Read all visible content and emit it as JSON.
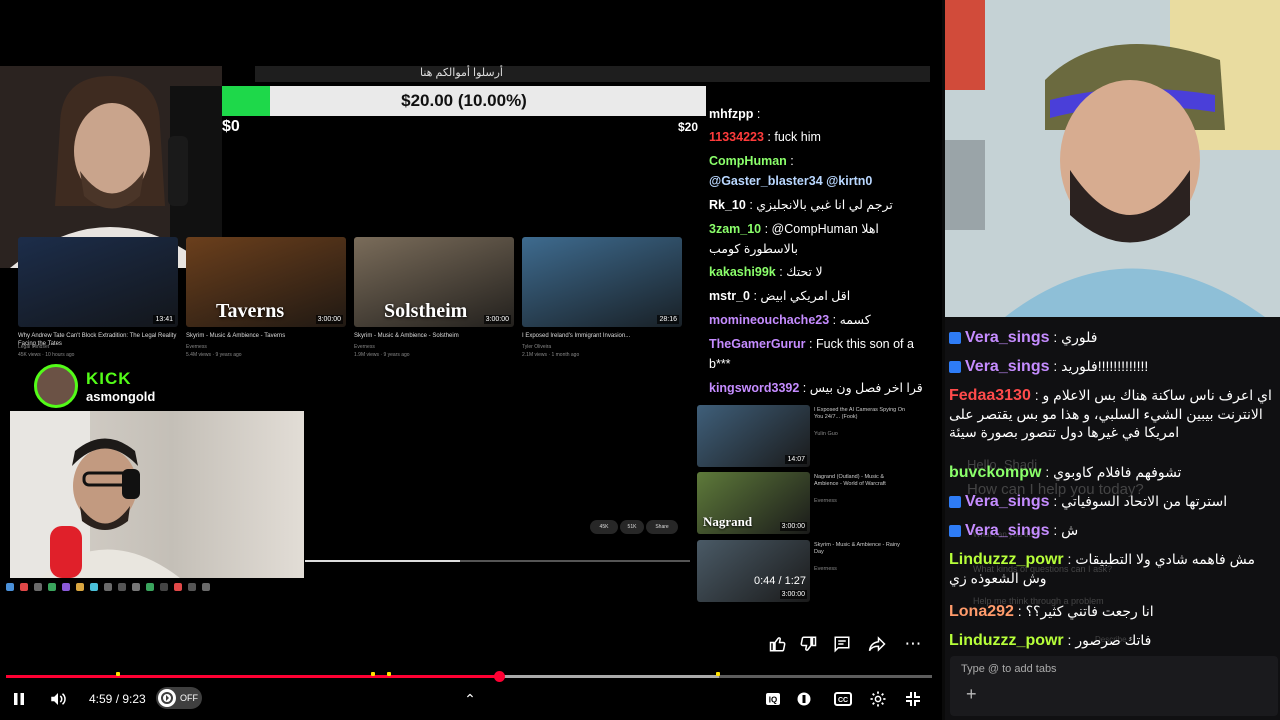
{
  "inner_window": {
    "title": "أرسلوا أموالكم هنا",
    "donation": {
      "label": "$20.00 (10.00%)",
      "progress": 0.1,
      "min_label": "$0",
      "max_label": "$20"
    },
    "thumbnails": [
      {
        "overlay": "",
        "title": "Why Andrew Tate Can't Block Extradition: The Legal Reality Facing the Tates",
        "channel": "Legal Mindset",
        "meta": "45K views · 10 hours ago",
        "duration": "13:41",
        "color": "#1c2d4a"
      },
      {
        "overlay": "Taverns",
        "title": "Skyrim - Music & Ambience - Taverns",
        "channel": "Everness",
        "meta": "5.4M views · 9 years ago",
        "duration": "3:00:00",
        "color": "#6b3f1c"
      },
      {
        "overlay": "Solstheim",
        "title": "Skyrim - Music & Ambience - Solstheim",
        "channel": "Everness",
        "meta": "1.9M views · 9 years ago",
        "duration": "3:00:00",
        "color": "#7a6c5a"
      },
      {
        "overlay": "",
        "title": "I Exposed Ireland's Immigrant Invasion...",
        "channel": "Tyler Oliveira",
        "meta": "2.1M views · 1 month ago",
        "duration": "28:16",
        "color": "#3e6b8f"
      }
    ],
    "kick": {
      "logo": "KICK",
      "username": "asmongold"
    },
    "chat": [
      {
        "user": "mhfzpp",
        "text": " : ",
        "color": "#ffffff"
      },
      {
        "user": "11334223",
        "text": " : fuck him",
        "color": "#ff3b3b"
      },
      {
        "user": "CompHuman",
        "text": " :",
        "color": "#8bff6b"
      },
      {
        "user": "@Gaster_blaster34 @kirtn0",
        "text": "",
        "color": "#b9d7ff"
      },
      {
        "user": "Rk_10",
        "text": " : ترجم لي انا غبي بالانجليزي",
        "color": "#ffffff"
      },
      {
        "user": "3zam_10",
        "text": " : @CompHuman اهلا",
        "color": "#8bff6b"
      },
      {
        "user": "",
        "text": "بالاسطورة كومب",
        "color": "#ffffff"
      },
      {
        "user": "kakashi99k",
        "text": " : لا تحتك",
        "color": "#8bff6b"
      },
      {
        "user": "mstr_0",
        "text": " : اقل امريكي ابيض",
        "color": "#ffffff"
      },
      {
        "user": "momineouchache23",
        "text": " : كسمه",
        "color": "#c58cff"
      },
      {
        "user": "TheGamerGurur",
        "text": " : Fuck this son of a",
        "color": "#c58cff"
      },
      {
        "user": "",
        "text": "b***",
        "color": "#ffffff"
      },
      {
        "user": "kingsword3392",
        "text": " : اقرا اخر فصل ون بيس",
        "color": "#c58cff"
      }
    ],
    "related": [
      {
        "title": "I Exposed the AI Cameras Spying On You 24/7... (Fook)",
        "channel": "Yulin Guo",
        "duration": "14:07",
        "color": "#3f5f7a"
      },
      {
        "title": "Nagrand (Outland) - Music & Ambience - World of Warcraft",
        "channel": "Everness",
        "overlay": "Nagrand",
        "duration": "3:00:00",
        "color": "#5e7a3a"
      },
      {
        "title": "Skyrim - Music & Ambience - Rainy Day",
        "channel": "Everness",
        "duration": "3:00:00",
        "color": "#4a5a66"
      }
    ],
    "time": "0:44 / 1:27",
    "pills": [
      "45K",
      "51K",
      "Share"
    ]
  },
  "player": {
    "time": "4:59 / 9:23",
    "autoplay": "OFF",
    "progress_played": 0.532,
    "progress_loaded": 0.77
  },
  "right_chat": {
    "messages": [
      {
        "user": "Vera_sings",
        "text": " : فلوري",
        "color": "#c58cff",
        "badge": true
      },
      {
        "user": "Vera_sings",
        "text": " : فلوريد!!!!!!!!!!!!!",
        "color": "#c58cff",
        "badge": true
      },
      {
        "user": "Fedaa3130",
        "text": " : اي اعرف ناس ساكنة هناك بس الاعلام و الانترنت بيبين الشيء السلبي، و هذا مو بس يقتصر على امريكا في غيرها دول تتصور بصورة سيئة",
        "color": "#ff4b4b",
        "badge": false
      },
      {
        "user": "buvckompw",
        "text": " : تشوفهم فافلام كاوبوي",
        "color": "#8bff6b",
        "badge": false
      },
      {
        "user": "Vera_sings",
        "text": " : استرتها من الاتحاد السوفياتي",
        "color": "#c58cff",
        "badge": true
      },
      {
        "user": "Vera_sings",
        "text": " : ش",
        "color": "#c58cff",
        "badge": true
      },
      {
        "user": "Linduzzz_powr",
        "text": " : مش فاهمه شادي ولا التطبيقات وش الشعوذه زي",
        "color": "#b7ff3a",
        "badge": false
      },
      {
        "user": "Lona292",
        "text": " : انا رجعت فاتني كثير؟؟",
        "color": "#ff9b6b",
        "badge": false
      },
      {
        "user": "Linduzzz_powr",
        "text": " : فاتك صرصور",
        "color": "#b7ff3a",
        "badge": false
      }
    ],
    "ghost": [
      "Hello, Shadi",
      "How can I help you today?",
      "What can you do?",
      "What kinds of questions can I ask?",
      "Help me think through a problem",
      "Describe"
    ],
    "input_placeholder": "Type @ to add tabs"
  },
  "icons": {
    "like": "thumbs-up-icon",
    "dislike": "thumbs-down-icon",
    "comment": "comment-icon",
    "share": "share-icon",
    "more": "more-icon",
    "pause": "pause-icon",
    "volume": "volume-icon",
    "chevron": "chevron-up-icon",
    "miniplayer": "miniplayer-icon",
    "info": "info-icon",
    "cc": "cc-icon",
    "settings": "gear-icon",
    "fullscreen": "fullscreen-exit-icon"
  },
  "colors": {
    "accent": "#ff0033",
    "kick": "#53fc18",
    "donation": "#1ed84a"
  }
}
